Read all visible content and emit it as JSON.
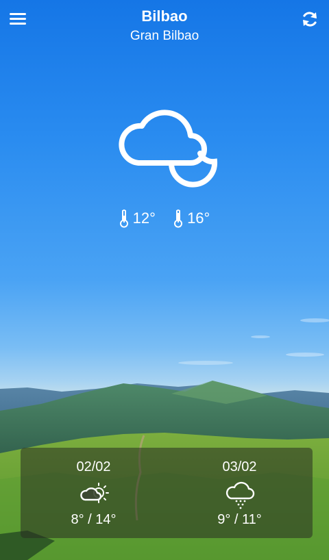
{
  "header": {
    "city": "Bilbao",
    "region": "Gran Bilbao"
  },
  "icons": {
    "menu": "hamburger-icon",
    "refresh": "refresh-icon",
    "current": "cloud-moon-icon",
    "thermometer": "thermometer-icon"
  },
  "current": {
    "min": "12°",
    "max": "16°"
  },
  "forecast": [
    {
      "date": "02/02",
      "icon": "cloud-sun-icon",
      "range": "8° / 14°"
    },
    {
      "date": "03/02",
      "icon": "cloud-drizzle-icon",
      "range": "9° / 11°"
    }
  ]
}
